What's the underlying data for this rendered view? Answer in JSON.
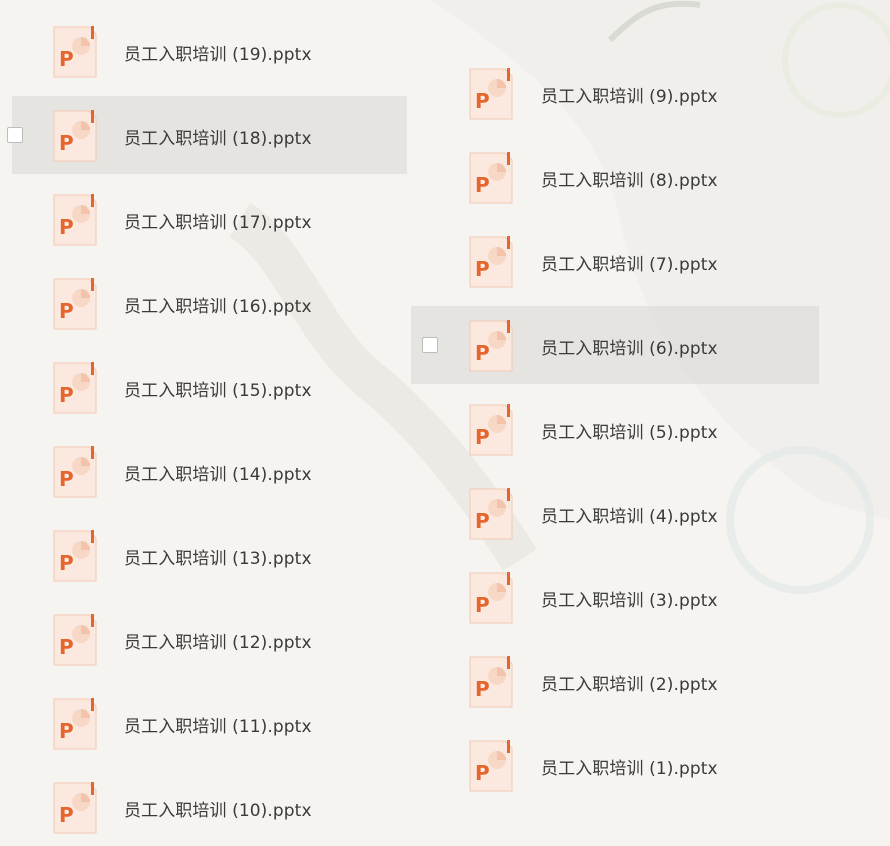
{
  "left_column": [
    {
      "name": "员工入职培训 (19).pptx",
      "selected": false
    },
    {
      "name": "员工入职培训 (18).pptx",
      "selected": true
    },
    {
      "name": "员工入职培训 (17).pptx",
      "selected": false
    },
    {
      "name": "员工入职培训 (16).pptx",
      "selected": false
    },
    {
      "name": "员工入职培训 (15).pptx",
      "selected": false
    },
    {
      "name": "员工入职培训 (14).pptx",
      "selected": false
    },
    {
      "name": "员工入职培训 (13).pptx",
      "selected": false
    },
    {
      "name": "员工入职培训 (12).pptx",
      "selected": false
    },
    {
      "name": "员工入职培训 (11).pptx",
      "selected": false
    },
    {
      "name": "员工入职培训 (10).pptx",
      "selected": false
    }
  ],
  "right_column": [
    {
      "name": "员工入职培训 (9).pptx",
      "selected": false
    },
    {
      "name": "员工入职培训 (8).pptx",
      "selected": false
    },
    {
      "name": "员工入职培训 (7).pptx",
      "selected": false
    },
    {
      "name": "员工入职培训 (6).pptx",
      "selected": true
    },
    {
      "name": "员工入职培训 (5).pptx",
      "selected": false
    },
    {
      "name": "员工入职培训 (4).pptx",
      "selected": false
    },
    {
      "name": "员工入职培训 (3).pptx",
      "selected": false
    },
    {
      "name": "员工入职培训 (2).pptx",
      "selected": false
    },
    {
      "name": "员工入职培训 (1).pptx",
      "selected": false
    }
  ],
  "icon": {
    "name": "powerpoint-file-icon",
    "letter": "P",
    "accent": "#e4652f"
  },
  "colors": {
    "selected_row": "#dcdad7",
    "text": "#3a3a3a"
  }
}
